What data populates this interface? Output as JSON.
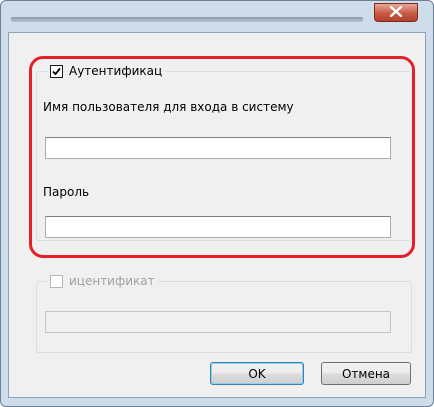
{
  "titlebar": {
    "close_icon": "close-icon"
  },
  "auth_group": {
    "checkbox_checked": true,
    "legend": "Аутентификац",
    "username_label": "Имя пользователя для входа в систему",
    "username_value": "",
    "password_label": "Пароль",
    "password_value": ""
  },
  "ident_group": {
    "checkbox_checked": false,
    "legend": "ицентификат",
    "field_value": ""
  },
  "buttons": {
    "ok_label": "OK",
    "cancel_label": "Отмена"
  },
  "colors": {
    "highlight": "#e4202b",
    "close_button": "#c75a45"
  }
}
